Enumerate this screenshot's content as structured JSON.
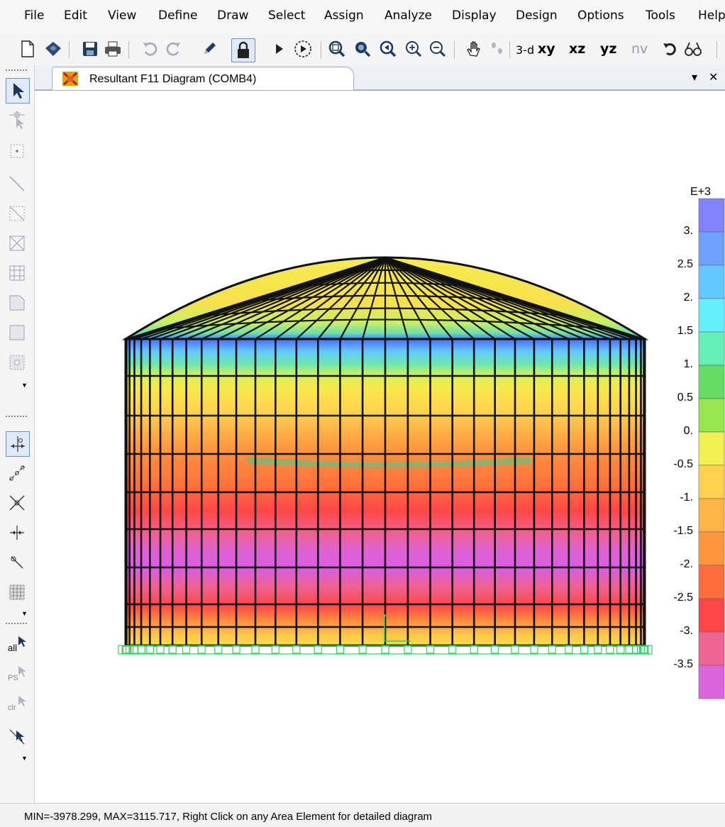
{
  "menu": [
    "File",
    "Edit",
    "View",
    "Define",
    "Draw",
    "Select",
    "Assign",
    "Analyze",
    "Display",
    "Design",
    "Options",
    "Tools",
    "Help"
  ],
  "toolbar": {
    "view_3d": "3-d",
    "view_xy": "xy",
    "view_xz": "xz",
    "view_yz": "yz",
    "view_nv": "nv"
  },
  "left_toolbar": {
    "all_label": "all",
    "ps_label": "PS",
    "clr_label": "clr"
  },
  "tab": {
    "title": "Resultant F11 Diagram  (COMB4)",
    "dropdown_glyph": "▾",
    "close_glyph": "✕"
  },
  "legend": {
    "exponent": "E+3",
    "labels": [
      "3.",
      "2.5",
      "2.",
      "1.5",
      "1.",
      "0.5",
      "0.",
      "-0.5",
      "-1.",
      "-1.5",
      "-2.",
      "-2.5",
      "-3.",
      "-3.5"
    ],
    "colors": [
      "#8282ff",
      "#6ea0ff",
      "#64c8ff",
      "#64f0ff",
      "#64f0b4",
      "#64dc64",
      "#96e650",
      "#f0f050",
      "#ffd250",
      "#ffb446",
      "#ff963c",
      "#ff6e3c",
      "#ff4646",
      "#f06496",
      "#dc64dc"
    ]
  },
  "status": {
    "text": "MIN=-3978.299, MAX=3115.717, Right Click on any Area Element for detailed diagram"
  }
}
